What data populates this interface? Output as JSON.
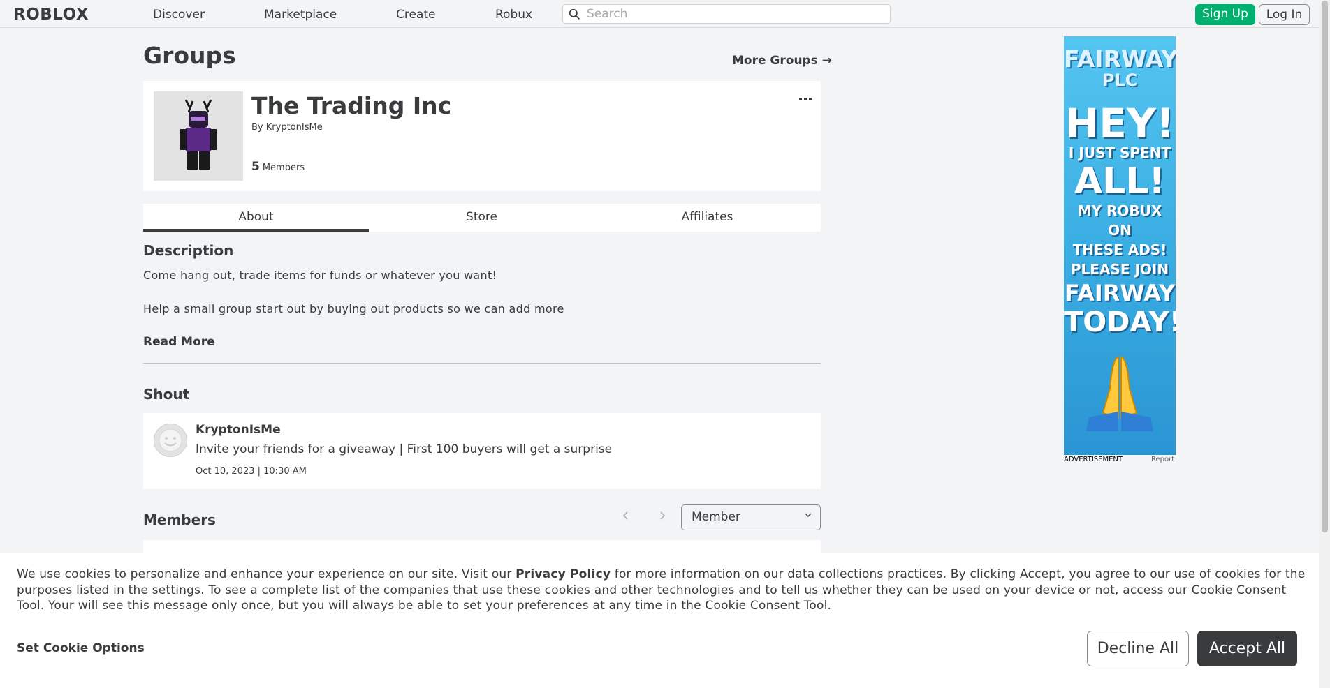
{
  "nav": {
    "logo": "ROBLOX",
    "links": [
      "Discover",
      "Marketplace",
      "Create",
      "Robux"
    ],
    "search_placeholder": "Search",
    "signup": "Sign Up",
    "login": "Log In"
  },
  "page": {
    "title": "Groups",
    "more_groups": "More Groups →"
  },
  "group": {
    "name": "The Trading Inc",
    "by_label": "By",
    "owner": "KryptonIsMe",
    "member_count": "5",
    "member_label": "Members",
    "more_icon": "ellipsis-icon"
  },
  "tabs": [
    "About",
    "Store",
    "Affiliates"
  ],
  "about": {
    "description_heading": "Description",
    "description_lines": [
      "Come hang out, trade items for funds or whatever you want!",
      "Help a small group start out by buying out products so we can add more"
    ],
    "read_more": "Read More"
  },
  "shout": {
    "heading": "Shout",
    "author": "KryptonIsMe",
    "body": "Invite your friends for a giveaway | First 100 buyers will get a surprise",
    "date": "Oct 10, 2023 | 10:30 AM"
  },
  "members": {
    "heading": "Members",
    "role_selected": "Member"
  },
  "ad": {
    "brand": "FAIRWAY",
    "brand2": "PLC",
    "lines": [
      "HEY!",
      "I JUST SPENT",
      "ALL!",
      "MY ROBUX ON",
      "THESE ADS!",
      "PLEASE JOIN",
      "FAIRWAY",
      "TODAY!"
    ],
    "label": "ADVERTISEMENT",
    "report": "Report"
  },
  "cookie": {
    "text_before": "We use cookies to personalize and enhance your experience on our site. Visit our ",
    "privacy_link": "Privacy Policy",
    "text_after": " for more information on our data collections practices. By clicking Accept, you agree to our use of cookies for the purposes listed in the settings. To see a complete list of the companies that use these cookies and other technologies and to tell us whether they can be used on your device or not, access our Cookie Consent Tool. Your will see this message only once, but you will always be able to set your preferences at any time in the Cookie Consent Tool.",
    "options": "Set Cookie Options",
    "decline": "Decline All",
    "accept": "Accept All"
  },
  "colors": {
    "signup_green": "#00b06f",
    "dark": "#393b3d",
    "background": "#f2f4f5"
  }
}
